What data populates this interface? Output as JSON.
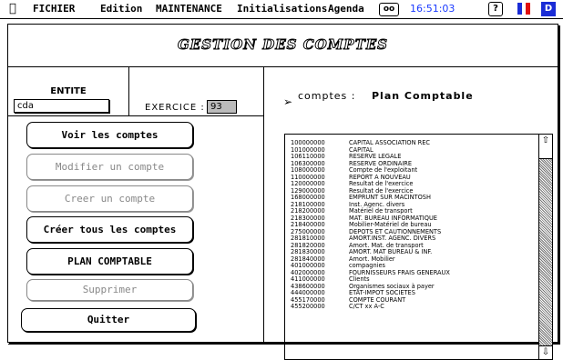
{
  "menubar": {
    "apple": "",
    "items": [
      "FICHIER",
      "Edition",
      "MAINTENANCE",
      "Initialisations",
      "Agenda"
    ],
    "clock": "16:51:03",
    "help": "?",
    "flag_colors": [
      "#1a2cd6",
      "#ffffff",
      "#e01010"
    ],
    "app_label": "D"
  },
  "window": {
    "title": "GESTION DES COMPTES"
  },
  "entite": {
    "label": "ENTITE",
    "value": "cda"
  },
  "exercice": {
    "label": "EXERCICE :",
    "value": "93"
  },
  "buttons": {
    "voir": "Voir les comptes",
    "modifier": "Modifier un compte",
    "creer": "Creer un compte",
    "creer_tous": "Créer tous les comptes",
    "plan": "PLAN COMPTABLE",
    "supprimer": "Supprimer",
    "quitter": "Quitter"
  },
  "comptes": {
    "label": "comptes :",
    "value": "Plan Comptable",
    "rows": [
      [
        "100000000",
        "CAPITAL ASSOCIATION REC"
      ],
      [
        "101000000",
        "CAPITAL"
      ],
      [
        "106110000",
        "RESERVE LEGALE"
      ],
      [
        "106300000",
        "RESERVE ORDINAIRE"
      ],
      [
        "108000000",
        "Compte de l'exploitant"
      ],
      [
        "110000000",
        "REPORT A NOUVEAU"
      ],
      [
        "120000000",
        "Resultat de l'exercice"
      ],
      [
        "129000000",
        "Resultat de l'exercice"
      ],
      [
        "168000000",
        "EMPRUNT SUR MACINTOSH"
      ],
      [
        "218100000",
        "Inst. Agenc. divers"
      ],
      [
        "218200000",
        "Matériel de transport"
      ],
      [
        "218300000",
        "MAT. BUREAU INFORMATIQUE"
      ],
      [
        "218400000",
        "Mobilier-Matériel de bureau"
      ],
      [
        "275000000",
        "DEPOTS ET CAUTIONNEMENTS"
      ],
      [
        "281810000",
        "AMORT.INST. AGENC. DIVERS"
      ],
      [
        "281820000",
        "Amort. Mat. de transport"
      ],
      [
        "281830000",
        "AMORT. MAT BUREAU & INF."
      ],
      [
        "281840000",
        "Amort. Mobilier"
      ],
      [
        "401000000",
        "compagnies"
      ],
      [
        "402000000",
        "FOURNISSEURS FRAIS GENERAUX"
      ],
      [
        "411000000",
        "Clients"
      ],
      [
        "438600000",
        "Organismes sociaux à payer"
      ],
      [
        "444000000",
        "ETAT-IMPOT SOCIETES"
      ],
      [
        "455170000",
        "COMPTE COURANT"
      ],
      [
        "455200000",
        "C/CT xx A-C"
      ]
    ]
  },
  "scroll": {
    "up": "⇧",
    "down": "⇩"
  }
}
